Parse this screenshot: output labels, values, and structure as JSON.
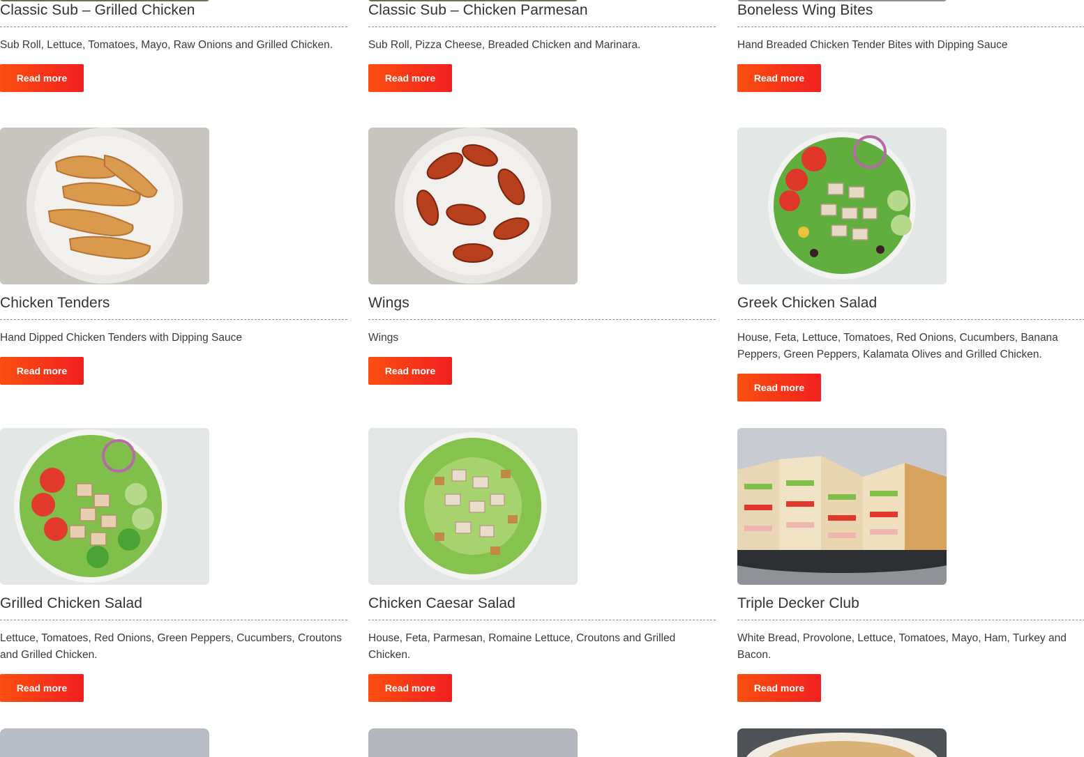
{
  "button_label": "Read more",
  "accent_gradient": [
    "#fb4f10",
    "#f21f1f"
  ],
  "columns": [
    {
      "items": [
        {
          "title": "Classic Sub – Grilled Chicken",
          "description": "Sub Roll, Lettuce, Tomatoes, Mayo, Raw Onions and Grilled Chicken.",
          "image": "grilled-chicken-sub-image"
        },
        {
          "title": "Chicken Tenders",
          "description": "Hand Dipped Chicken Tenders with Dipping Sauce",
          "image": "chicken-tenders-image"
        },
        {
          "title": "Grilled Chicken Salad",
          "description": "Lettuce, Tomatoes, Red Onions, Green Peppers, Cucumbers, Croutons and Grilled Chicken.",
          "image": "grilled-chicken-salad-image"
        }
      ]
    },
    {
      "items": [
        {
          "title": "Classic Sub – Chicken Parmesan",
          "description": "Sub Roll, Pizza Cheese, Breaded Chicken and Marinara.",
          "image": "chicken-parmesan-sub-image"
        },
        {
          "title": "Wings",
          "description": "Wings",
          "image": "wings-image"
        },
        {
          "title": "Chicken Caesar Salad",
          "description": "House, Feta, Parmesan, Romaine Lettuce, Croutons and Grilled Chicken.",
          "image": "chicken-caesar-salad-image"
        }
      ]
    },
    {
      "items": [
        {
          "title": "Boneless Wing Bites",
          "description": "Hand Breaded Chicken Tender Bites with Dipping Sauce",
          "image": "boneless-wing-bites-image"
        },
        {
          "title": "Greek Chicken Salad",
          "description": "House, Feta, Lettuce, Tomatoes, Red Onions, Cucumbers, Banana Peppers, Green Peppers, Kalamata Olives and Grilled Chicken.",
          "image": "greek-chicken-salad-image"
        },
        {
          "title": "Triple Decker Club",
          "description": "White Bread, Provolone, Lettuce, Tomatoes, Mayo, Ham, Turkey and Bacon.",
          "image": "triple-decker-club-image"
        }
      ]
    }
  ]
}
